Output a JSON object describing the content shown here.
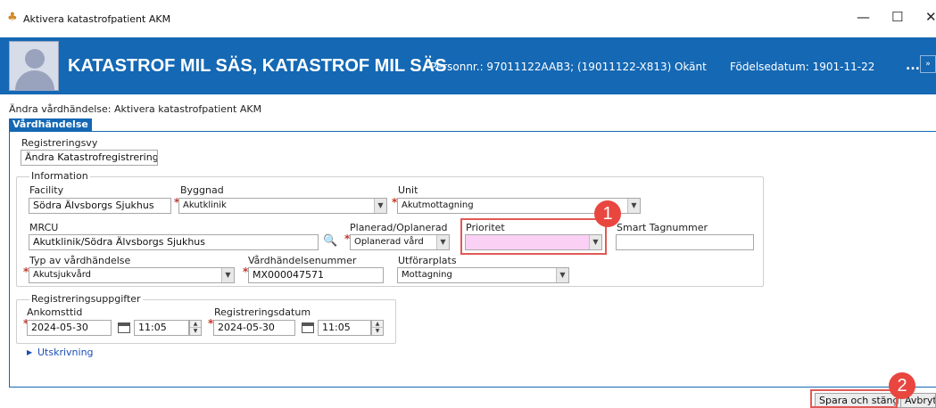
{
  "window": {
    "title": "Aktivera katastrofpatient AKM",
    "minimize": "—",
    "maximize": "☐",
    "close": "✕"
  },
  "header": {
    "patient_name": "KATASTROF MIL SÄS, KATASTROF MIL SÄS",
    "personnr": "Personnr.: 97011122AAB3; (19011122-X813)",
    "gender": "Okänt",
    "birthdate": "Födelsedatum: 1901-11-22",
    "more": "...",
    "more_btn": "»"
  },
  "page": {
    "title": "Ändra vårdhändelse: Aktivera katastrofpatient AKM",
    "tab": "Vårdhändelse"
  },
  "registreringsvy": {
    "label": "Registreringsvy",
    "value": "Ändra Katastrofregistrering"
  },
  "information": {
    "legend": "Information",
    "facility_label": "Facility",
    "facility_value": "Södra Älvsborgs Sjukhus",
    "byggnad_label": "Byggnad",
    "byggnad_value": "Akutklinik",
    "unit_label": "Unit",
    "unit_value": "Akutmottagning",
    "mrcu_label": "MRCU",
    "mrcu_value": "Akutklinik/Södra Älvsborgs Sjukhus",
    "planerad_label": "Planerad/Oplanerad",
    "planerad_value": "Oplanerad vård",
    "prioritet_label": "Prioritet",
    "prioritet_value": "",
    "smart_label": "Smart Tagnummer",
    "smart_value": "",
    "typ_label": "Typ av vårdhändelse",
    "typ_value": "Akutsjukvård",
    "nummer_label": "Vårdhändelsenummer",
    "nummer_value": "MX000047571",
    "utforar_label": "Utförarplats",
    "utforar_value": "Mottagning"
  },
  "registrering": {
    "legend": "Registreringsuppgifter",
    "ankomst_label": "Ankomsttid",
    "ankomst_date": "2024-05-30",
    "ankomst_time": "11:05",
    "regdatum_label": "Registreringsdatum",
    "reg_date": "2024-05-30",
    "reg_time": "11:05"
  },
  "utskrivning": "Utskrivning",
  "buttons": {
    "save": "Spara och stäng",
    "cancel": "Avbryt"
  },
  "annotations": {
    "badge1": "1",
    "badge2": "2",
    "color": "#e8463f"
  },
  "colors": {
    "header_blue": "#1468b4",
    "prioritet_fill": "#fbd0f5"
  }
}
